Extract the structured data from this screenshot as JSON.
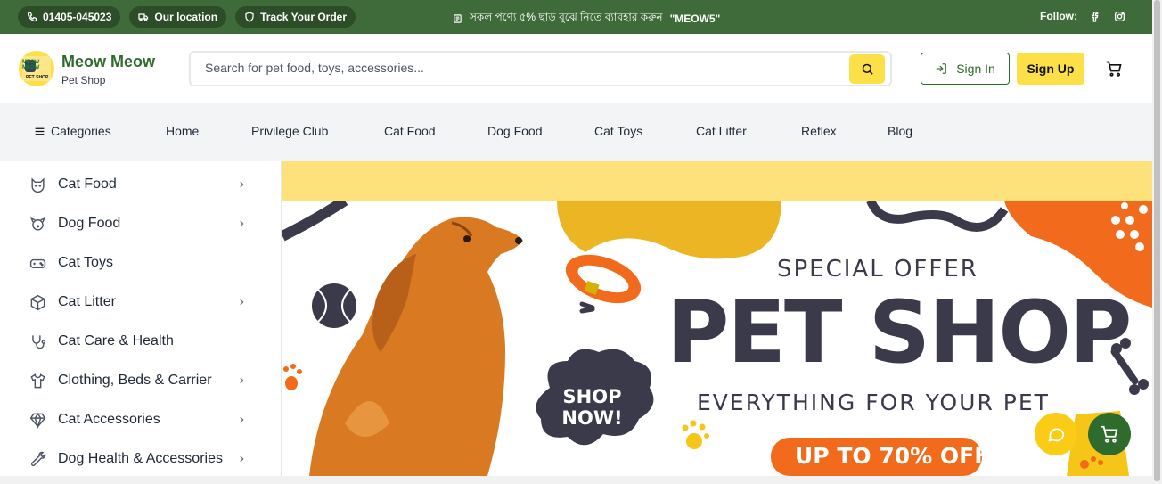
{
  "topbar": {
    "phone": "01405-045023",
    "location": "Our location",
    "track": "Track Your Order",
    "promo_text": "সকল পণ্যে ৫% ছাড় বুঝে নিতে ব্যাবহার করুন",
    "promo_code": "\"MEOW5\"",
    "follow_label": "Follow:"
  },
  "header": {
    "brand_name": "Meow Meow",
    "brand_sub": "Pet Shop",
    "logo_text": "MEOW MEOW",
    "logo_sub": "PET SHOP",
    "search_placeholder": "Search for pet food, toys, accessories...",
    "signin_label": "Sign In",
    "signup_label": "Sign Up"
  },
  "nav": {
    "categories_label": "Categories",
    "items": [
      "Home",
      "Privilege Club",
      "Cat Food",
      "Dog Food",
      "Cat Toys",
      "Cat Litter",
      "Reflex",
      "Blog"
    ]
  },
  "sidebar": {
    "items": [
      {
        "label": "Cat Food",
        "icon": "cat-face-icon",
        "has_children": true
      },
      {
        "label": "Dog Food",
        "icon": "dog-face-icon",
        "has_children": true
      },
      {
        "label": "Cat Toys",
        "icon": "gamepad-icon",
        "has_children": false
      },
      {
        "label": "Cat Litter",
        "icon": "box-icon",
        "has_children": true
      },
      {
        "label": "Cat Care & Health",
        "icon": "stethoscope-icon",
        "has_children": false
      },
      {
        "label": "Clothing, Beds & Carrier",
        "icon": "shirt-icon",
        "has_children": true
      },
      {
        "label": "Cat Accessories",
        "icon": "gem-icon",
        "has_children": true
      },
      {
        "label": "Dog Health & Accessories",
        "icon": "wrench-icon",
        "has_children": true
      }
    ]
  },
  "banner": {
    "special": "SPECIAL OFFER",
    "title": "PET SHOP",
    "subtitle": "EVERYTHING FOR YOUR PET",
    "offer": "UP TO 70% OFF",
    "shop_now_1": "SHOP",
    "shop_now_2": "NOW!"
  },
  "colors": {
    "brand_green": "#2f6b2c",
    "topbar_green": "#3f6b3a",
    "accent_yellow": "#fde047",
    "banner_orange": "#f26a1b",
    "banner_dark": "#3b3a4a"
  }
}
